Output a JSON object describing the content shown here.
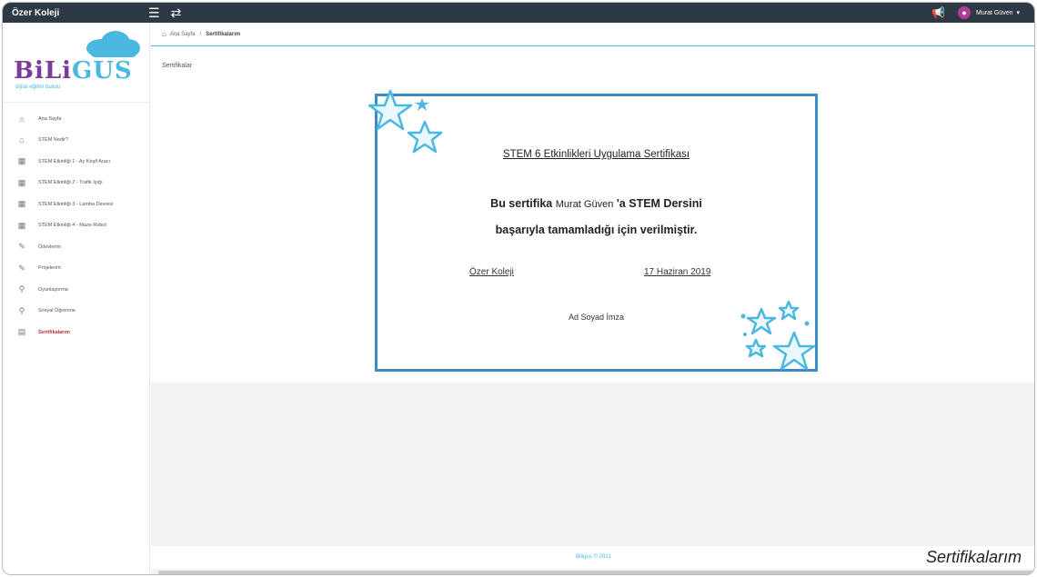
{
  "topbar": {
    "brand": "Özer Koleji",
    "user_name": "Murat Güven",
    "icons": [
      "menu-icon",
      "swap-icon",
      "megaphone-icon",
      "user-avatar-icon",
      "chevron-down-icon"
    ]
  },
  "sidebar": {
    "logo_text_1": "BiLi",
    "logo_text_2": "GUS",
    "logo_sub": "dijital eğitim bulutu",
    "items": [
      {
        "label": "Ana Sayfa",
        "icon": "home-icon"
      },
      {
        "label": "STEM Nedir?",
        "icon": "home-icon"
      },
      {
        "label": "STEM Etkinliği 1 - Ay Keşif Aracı",
        "icon": "layers-icon"
      },
      {
        "label": "STEM Etkinliği 2 - Trafik Işığı",
        "icon": "layers-icon"
      },
      {
        "label": "STEM Etkinliği 3 - Lamba Devresi",
        "icon": "layers-icon"
      },
      {
        "label": "STEM Etkinliği 4 - Maze Robot",
        "icon": "layers-icon"
      },
      {
        "label": "Ödevlerim",
        "icon": "edit-icon"
      },
      {
        "label": "Projelerim",
        "icon": "edit-icon"
      },
      {
        "label": "Oyunlaştırma",
        "icon": "pin-icon"
      },
      {
        "label": "Sosyal Öğrenme",
        "icon": "pin-icon"
      },
      {
        "label": "Sertifikalarım",
        "icon": "file-icon",
        "active": true
      }
    ]
  },
  "breadcrumb": {
    "home": "Ana Sayfa",
    "separator": "/",
    "current": "Sertifikalarım"
  },
  "panel": {
    "title": "Sertifikalar"
  },
  "certificate": {
    "title": "STEM 6 Etkinlikleri Uygulama Sertifikası",
    "line1_pre": "Bu sertifika",
    "recipient": "Murat Güven",
    "line1_post": "'a STEM Dersini",
    "line2": "başarıyla tamamladığı için verilmiştir.",
    "school": "Özer Koleji",
    "date": "17 Haziran 2019",
    "signature": "Ad Soyad İmza"
  },
  "footer": {
    "text": "Biligus © 2021"
  },
  "caption": "Sertifikalarım",
  "colors": {
    "topbar": "#2d3a46",
    "accent": "#4bb8e0",
    "border": "#3a8cc9",
    "active": "#c62828"
  }
}
